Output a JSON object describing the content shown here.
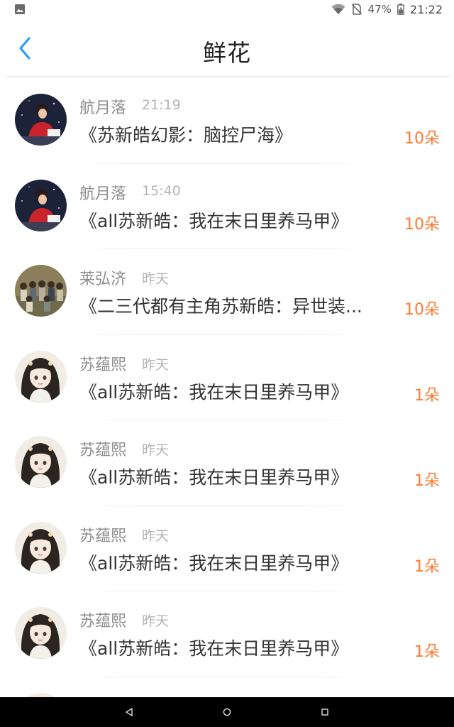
{
  "status_bar": {
    "battery": "47%",
    "time": "21:22",
    "icons": [
      "image-notification-icon",
      "wifi-icon",
      "no-sim-icon",
      "battery-icon"
    ]
  },
  "header": {
    "title": "鲜花",
    "back_icon": "chevron-left-icon"
  },
  "colors": {
    "accent_blue": "#2a9df4",
    "flower_orange": "#ff7a2f",
    "name_gray": "#8e8e8e",
    "time_gray": "#b3b3b3",
    "title_dark": "#333333"
  },
  "records": [
    {
      "user": "航月落",
      "time": "21:19",
      "book": "《苏新皓幻影：脑控尸海》",
      "count": "10朵",
      "avatar": "avatar-red-performer"
    },
    {
      "user": "航月落",
      "time": "15:40",
      "book": "《all苏新皓：我在末日里养马甲》",
      "count": "10朵",
      "avatar": "avatar-red-performer"
    },
    {
      "user": "莱弘济",
      "time": "昨天",
      "book": "《二三代都有主角苏新皓：异世装...",
      "count": "10朵",
      "avatar": "avatar-group-photo"
    },
    {
      "user": "苏蕴熙",
      "time": "昨天",
      "book": "《all苏新皓：我在末日里养马甲》",
      "count": "1朵",
      "avatar": "avatar-anime-girl"
    },
    {
      "user": "苏蕴熙",
      "time": "昨天",
      "book": "《all苏新皓：我在末日里养马甲》",
      "count": "1朵",
      "avatar": "avatar-anime-girl"
    },
    {
      "user": "苏蕴熙",
      "time": "昨天",
      "book": "《all苏新皓：我在末日里养马甲》",
      "count": "1朵",
      "avatar": "avatar-anime-girl"
    },
    {
      "user": "苏蕴熙",
      "time": "昨天",
      "book": "《all苏新皓：我在末日里养马甲》",
      "count": "1朵",
      "avatar": "avatar-anime-girl"
    }
  ],
  "nav_bar": {
    "buttons": [
      "back-triangle-icon",
      "home-circle-icon",
      "recents-square-icon"
    ]
  }
}
